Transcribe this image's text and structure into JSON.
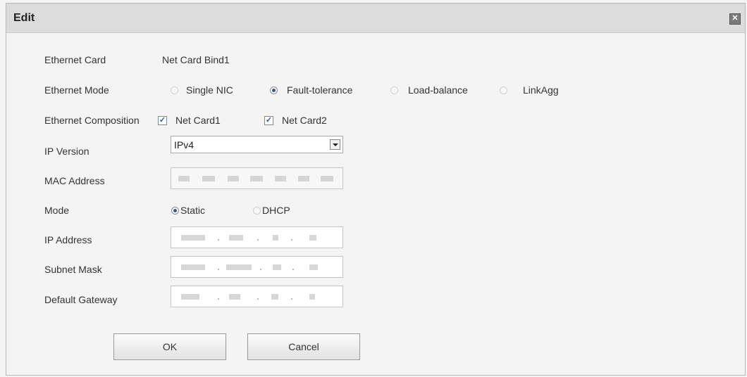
{
  "dialog": {
    "title": "Edit"
  },
  "form": {
    "ethernet_card": {
      "label": "Ethernet Card",
      "value": "Net Card Bind1"
    },
    "ethernet_mode": {
      "label": "Ethernet Mode",
      "options": [
        "Single NIC",
        "Fault-tolerance",
        "Load-balance",
        "LinkAgg"
      ],
      "selected": "Fault-tolerance"
    },
    "ethernet_composition": {
      "label": "Ethernet Composition",
      "items": [
        {
          "label": "Net Card1",
          "checked": true
        },
        {
          "label": "Net Card2",
          "checked": true
        }
      ]
    },
    "ip_version": {
      "label": "IP Version",
      "value": "IPv4"
    },
    "mac_address": {
      "label": "MAC Address"
    },
    "mode": {
      "label": "Mode",
      "options": [
        "Static",
        "DHCP"
      ],
      "selected": "Static"
    },
    "ip_address": {
      "label": "IP Address"
    },
    "subnet_mask": {
      "label": "Subnet Mask"
    },
    "default_gateway": {
      "label": "Default Gateway"
    }
  },
  "buttons": {
    "ok": "OK",
    "cancel": "Cancel"
  },
  "icons": {
    "close": "close-icon",
    "dropdown": "chevron-down-icon"
  },
  "colors": {
    "titlebar": "#dcdcdc",
    "background": "#f4f4f4",
    "radio_accent": "#2c5a8a",
    "check_accent": "#1f5fa5"
  }
}
